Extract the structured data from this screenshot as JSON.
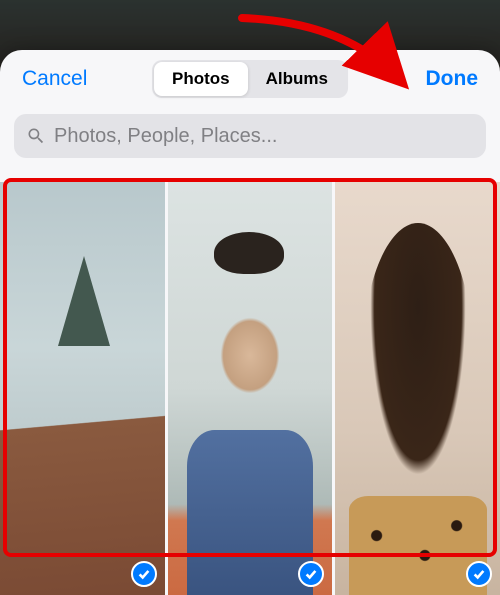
{
  "colors": {
    "accent": "#007aff",
    "annotation": "#e60000"
  },
  "nav": {
    "cancel_label": "Cancel",
    "done_label": "Done"
  },
  "segmented": {
    "option_photos": "Photos",
    "option_albums": "Albums",
    "selected": "Photos"
  },
  "search": {
    "placeholder": "Photos, People, Places...",
    "value": ""
  },
  "photos": [
    {
      "selected": true,
      "alt": "architecture-building"
    },
    {
      "selected": true,
      "alt": "man-profile"
    },
    {
      "selected": true,
      "alt": "woman-smiling"
    }
  ],
  "annotation": {
    "arrow_target": "done-button",
    "highlight_target": "photo-grid"
  }
}
